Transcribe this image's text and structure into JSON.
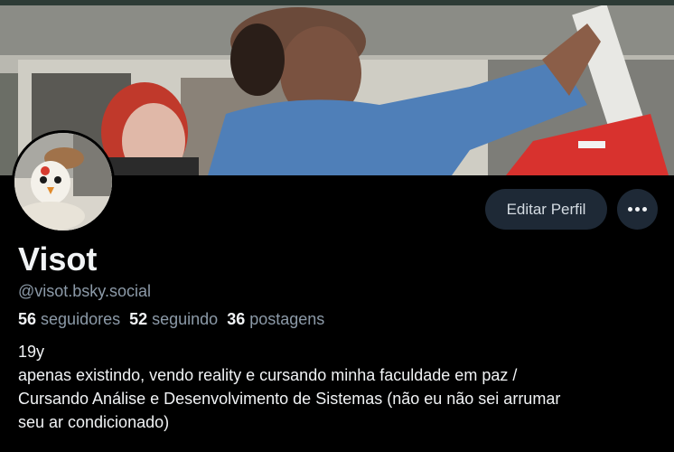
{
  "profile": {
    "display_name": "Visot",
    "handle": "@visot.bsky.social",
    "bio_lines": [
      "19y",
      "apenas existindo, vendo reality e cursando minha faculdade em paz /",
      "Cursando Análise e Desenvolvimento de Sistemas (não eu não sei arrumar",
      "seu ar condicionado)"
    ]
  },
  "stats": {
    "followers": {
      "count": "56",
      "label": "seguidores"
    },
    "following": {
      "count": "52",
      "label": "seguindo"
    },
    "posts": {
      "count": "36",
      "label": "postagens"
    }
  },
  "actions": {
    "edit_profile_label": "Editar Perfil",
    "more_icon": "ellipsis-icon"
  },
  "colors": {
    "background": "#000000",
    "button_bg": "#1e2936",
    "muted_text": "#8c9aa8",
    "primary_text": "#f1f3f5"
  }
}
